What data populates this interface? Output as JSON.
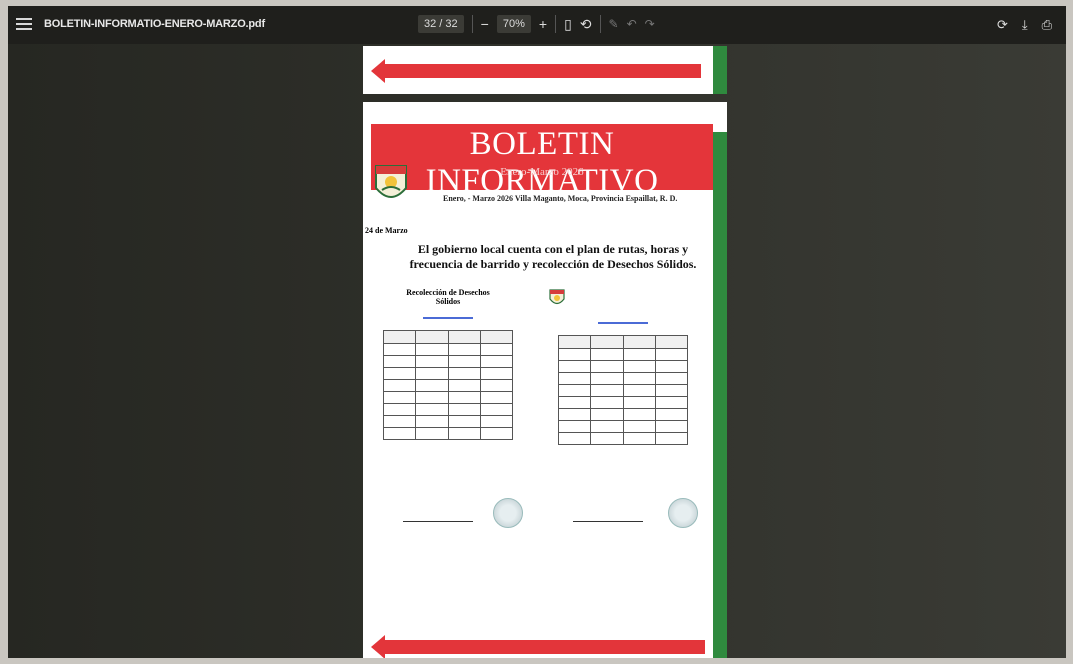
{
  "toolbar": {
    "menu_icon": "hamburger-menu-icon",
    "file_name": "BOLETIN-INFORMATIO-ENERO-MARZO.pdf",
    "page_current": "32",
    "page_total": "32",
    "zoom_minus": "−",
    "zoom_level": "70%",
    "zoom_plus": "+",
    "right_icons": [
      "rotate-icon",
      "download-icon",
      "print-icon"
    ]
  },
  "document": {
    "banner_title": "BOLETIN INFORMATIVO",
    "banner_subtitle": "Enero-Marzo 2026",
    "dateline": "Enero, - Marzo 2026 Villa Maganto, Moca, Provincia Espaillat, R. D.",
    "date_label": "24 de Marzo",
    "headline": "El gobierno local cuenta con el plan de rutas, horas y frecuencia de barrido y recolección de Desechos Sólidos.",
    "left_doc_title": "Recolección de Desechos Sólidos"
  },
  "colors": {
    "banner_red": "#e4353a",
    "accent_green": "#2f8a3e",
    "toolbar_bg": "#1f1f1c"
  }
}
